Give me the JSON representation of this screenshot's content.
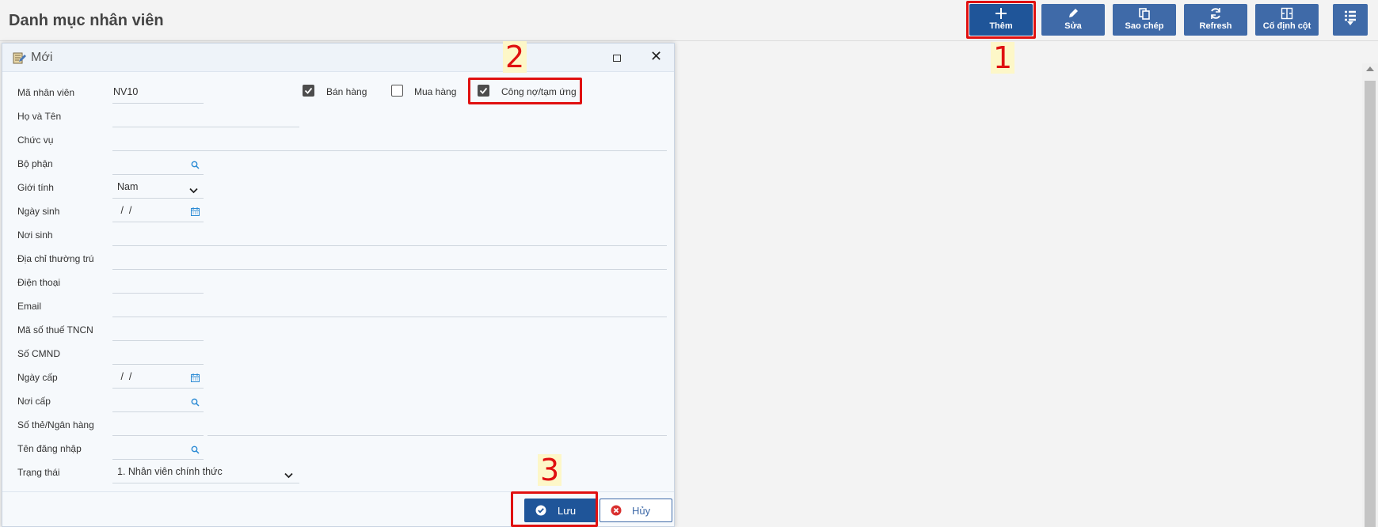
{
  "page": {
    "title": "Danh mục nhân viên"
  },
  "toolbar": {
    "add": "Thêm",
    "edit": "Sửa",
    "copy": "Sao chép",
    "refresh": "Refresh",
    "freeze": "Cố định cột"
  },
  "annotations": {
    "step1": "1",
    "step2": "2",
    "step3": "3"
  },
  "dialog": {
    "title": "Mới",
    "fields": {
      "code_label": "Mã nhân viên",
      "code_value": "NV10",
      "name_label": "Họ và Tên",
      "position_label": "Chức vụ",
      "dept_label": "Bộ phận",
      "gender_label": "Giới tính",
      "gender_value": "Nam",
      "birth_label": "Ngày sinh",
      "birth_value": " /  /",
      "birthplace_label": "Nơi sinh",
      "address_label": "Địa chỉ thường trú",
      "phone_label": "Điện thoại",
      "email_label": "Email",
      "tax_label": "Mã số thuế TNCN",
      "id_label": "Số CMND",
      "issue_date_label": "Ngày cấp",
      "issue_date_value": " /  /",
      "issue_place_label": "Nơi cấp",
      "bank_label": "Số thẻ/Ngân hàng",
      "login_label": "Tên đăng nhập",
      "status_label": "Trạng thái",
      "status_value": "1. Nhân viên chính thức"
    },
    "checkboxes": {
      "sales": {
        "label": "Bán hàng",
        "checked": true
      },
      "purchase": {
        "label": "Mua hàng",
        "checked": false
      },
      "debt": {
        "label": "Công nợ/tạm ứng",
        "checked": true
      }
    },
    "buttons": {
      "save": "Lưu",
      "cancel": "Hủy"
    }
  },
  "colors": {
    "primary": "#1f5599",
    "toolbar": "#3f6aa8",
    "highlight": "#e01010"
  }
}
